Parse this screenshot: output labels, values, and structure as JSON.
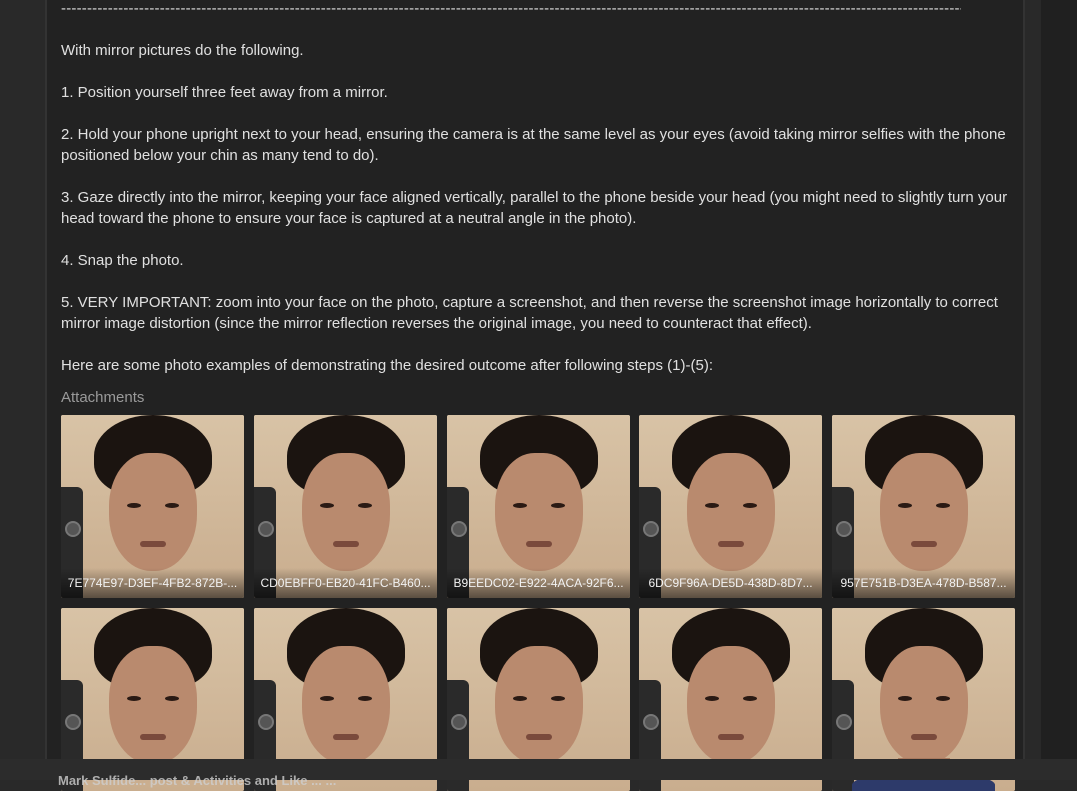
{
  "post": {
    "separator": "----------------------------------------------------------------------------------------------------------------------------------------------------------------------------------------------------------------------",
    "paragraphs": [
      "With mirror pictures do the following.",
      "1. Position yourself three feet away from a mirror.",
      "2. Hold your phone upright next to your head, ensuring the camera is at the same level as your eyes (avoid taking mirror selfies with the phone positioned below your chin as many tend to do).",
      "3. Gaze directly into the mirror, keeping your face aligned vertically, parallel to the phone beside your head (you might need to slightly turn your head toward the phone to ensure your face is captured at a neutral angle in the photo).",
      "4. Snap the photo.",
      "5. VERY IMPORTANT: zoom into your face on the photo, capture a screenshot, and then reverse the screenshot image horizontally to correct mirror image distortion (since the mirror reflection reverses the original image, you need to counteract that effect).",
      "Here are some photo examples of demonstrating the desired outcome after following steps (1)-(5):"
    ],
    "attachments_label": "Attachments",
    "attachments": [
      {
        "caption": "7E774E97-D3EF-4FB2-872B-..."
      },
      {
        "caption": "CD0EBFF0-EB20-41FC-B460..."
      },
      {
        "caption": "B9EEDC02-E922-4ACA-92F6..."
      },
      {
        "caption": "6DC9F96A-DE5D-438D-8D7..."
      },
      {
        "caption": "957E751B-D3EA-478D-B587..."
      },
      {
        "caption": ""
      },
      {
        "caption": ""
      },
      {
        "caption": ""
      },
      {
        "caption": ""
      },
      {
        "caption": ""
      }
    ]
  },
  "bottom_bar": {
    "text": "Mark Sulfide... post & Activities and Like ... ..."
  },
  "colors": {
    "page_bg": "#292929",
    "post_bg": "#222222",
    "text": "#e0e0e0",
    "muted": "#9a9a9a"
  }
}
